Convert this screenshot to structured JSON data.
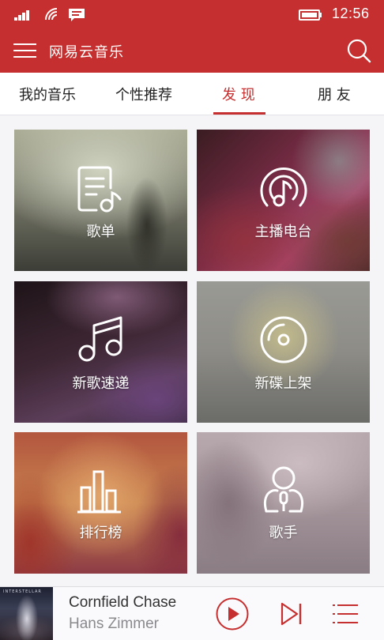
{
  "status_bar": {
    "time": "12:56",
    "icons": [
      "signal-icon",
      "wifi-icon",
      "message-icon",
      "battery-icon"
    ]
  },
  "app_bar": {
    "title": "网易云音乐",
    "icons": [
      "menu-icon",
      "search-icon"
    ]
  },
  "tabs": [
    {
      "label": "我的音乐",
      "active": false
    },
    {
      "label": "个性推荐",
      "active": false
    },
    {
      "label": "发 现",
      "active": true
    },
    {
      "label": "朋 友",
      "active": false
    }
  ],
  "tiles": [
    {
      "label": "歌单",
      "icon": "playlist-icon"
    },
    {
      "label": "主播电台",
      "icon": "radio-icon"
    },
    {
      "label": "新歌速递",
      "icon": "music-note-icon"
    },
    {
      "label": "新碟上架",
      "icon": "disc-icon"
    },
    {
      "label": "排行榜",
      "icon": "chart-bars-icon"
    },
    {
      "label": "歌手",
      "icon": "singer-icon"
    }
  ],
  "player": {
    "song_title": "Cornfield Chase",
    "artist": "Hans Zimmer",
    "cover_text": "INTERSTELLAR",
    "icons": [
      "play-icon",
      "next-icon",
      "playlist-menu-icon"
    ]
  },
  "colors": {
    "brand_red": "#c62f2f",
    "tab_text": "#222222",
    "background": "#f5f5f8"
  }
}
